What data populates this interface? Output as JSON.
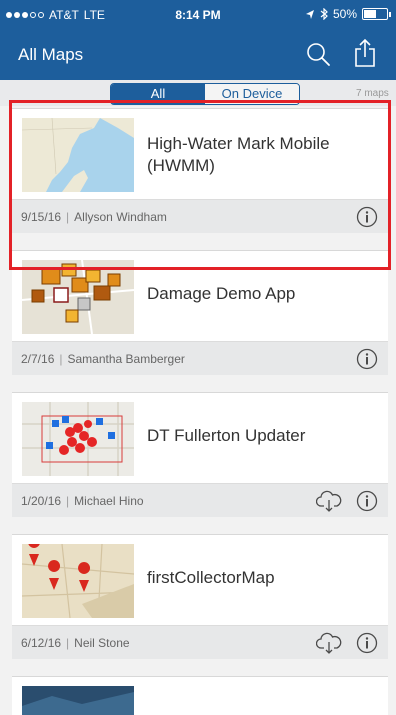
{
  "status_bar": {
    "carrier": "AT&T",
    "network": "LTE",
    "time": "8:14 PM",
    "battery": "50%"
  },
  "nav": {
    "title": "All Maps",
    "search_icon": "search-icon",
    "share_icon": "share-icon"
  },
  "filter": {
    "all_label": "All",
    "on_device_label": "On Device",
    "selected": "All",
    "count_text": "7 maps"
  },
  "maps": [
    {
      "title": "High-Water Mark Mobile (HWMM)",
      "date": "9/15/16",
      "owner": "Allyson Windham",
      "downloadable": false
    },
    {
      "title": "Damage Demo App",
      "date": "2/7/16",
      "owner": "Samantha Bamberger",
      "downloadable": false
    },
    {
      "title": "DT Fullerton Updater",
      "date": "1/20/16",
      "owner": "Michael Hino",
      "downloadable": true
    },
    {
      "title": "firstCollectorMap",
      "date": "6/12/16",
      "owner": "Neil Stone",
      "downloadable": true
    }
  ],
  "colors": {
    "brand": "#1d5e9c",
    "selection": "#e32127",
    "footer": "#e7e8e9"
  }
}
